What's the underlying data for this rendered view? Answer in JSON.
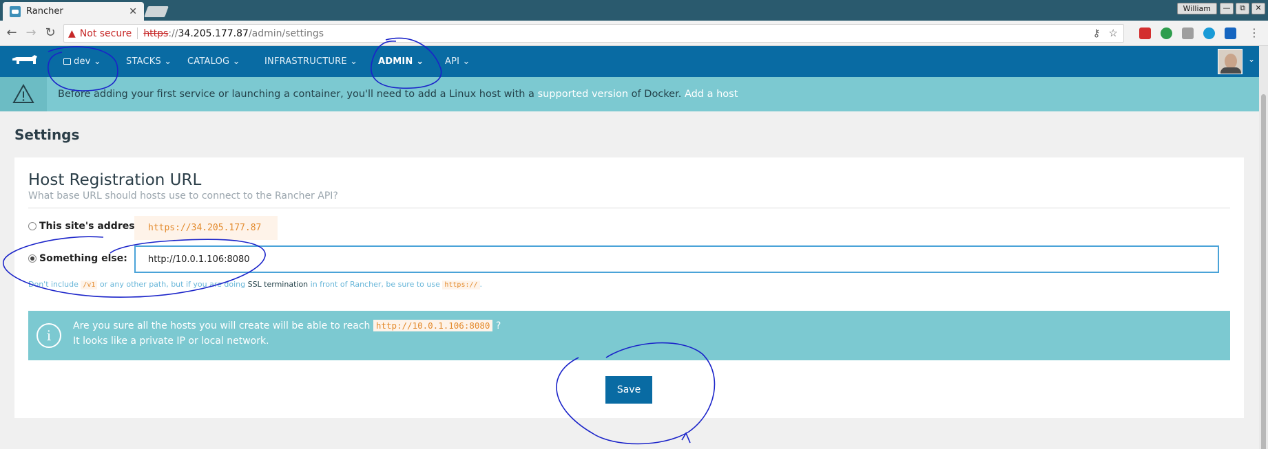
{
  "browser": {
    "tab_title": "Rancher",
    "tab_close": "✕",
    "user": "William",
    "win_buttons": [
      "—",
      "⧉",
      "✕"
    ]
  },
  "addressbar": {
    "not_secure": "Not secure",
    "url_scheme": "https",
    "url_sep": "://",
    "url_host": "34.205.177.87",
    "url_path": "/admin/settings"
  },
  "rancher_nav": {
    "env": "dev",
    "items": [
      "STACKS",
      "CATALOG",
      "INFRASTRUCTURE",
      "ADMIN",
      "API"
    ],
    "caret": "⌄"
  },
  "banner": {
    "text_before": "Before adding your first service or launching a container, you'll need to add a Linux host with a ",
    "link_supported": "supported version",
    "text_middle": " of Docker. ",
    "link_add_host": "Add a host"
  },
  "page": {
    "title": "Settings"
  },
  "host_registration": {
    "title": "Host Registration URL",
    "subtitle": "What base URL should hosts use to connect to the Rancher API?",
    "option_site_label": "This site's address:",
    "option_site_value": "https://34.205.177.87",
    "option_else_label": "Something else:",
    "option_else_value": "http://10.0.1.106:8080",
    "help_1": "Don't include ",
    "help_code_1": "/v1",
    "help_2": " or any other path, but if you are doing ",
    "help_dark": "SSL termination",
    "help_3": " in front of Rancher, be sure to use ",
    "help_code_2": "https://",
    "help_4": "."
  },
  "warning": {
    "line1_before": "Are you sure all the hosts you will create will be able to reach ",
    "line1_code": "http://10.0.1.106:8080",
    "line1_after": " ?",
    "line2": "It looks like a private IP or local network."
  },
  "actions": {
    "save": "Save"
  },
  "colors": {
    "brand_blue": "#096ba3",
    "banner_teal": "#7cc9d1",
    "annotation_ink": "#1a23c9"
  }
}
